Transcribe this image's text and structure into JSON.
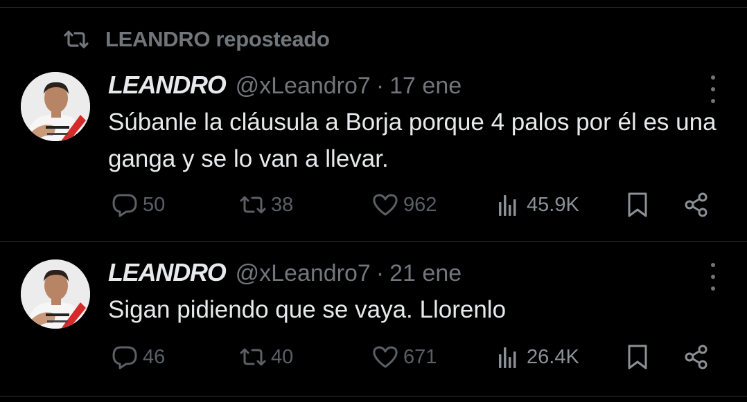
{
  "repost": {
    "label": "LEANDRO reposteado",
    "icon": "repost-icon"
  },
  "tweets": [
    {
      "name": "LEANDRO",
      "handle": "@xLeandro7",
      "separator": "·",
      "date": "17 ene",
      "text": "Súbanle la cláusula a Borja porque 4 palos por él es una ganga y se lo van a llevar.",
      "replies": "50",
      "reposts": "38",
      "likes": "962",
      "views": "45.9K"
    },
    {
      "name": "LEANDRO",
      "handle": "@xLeandro7",
      "separator": "·",
      "date": "21 ene",
      "text": "Sigan pidiendo que se vaya. Llorenlo",
      "replies": "46",
      "reposts": "40",
      "likes": "671",
      "views": "26.4K"
    }
  ],
  "icons": [
    "repost-icon",
    "more-icon",
    "reply-icon",
    "retweet-icon",
    "like-icon",
    "views-icon",
    "bookmark-icon",
    "share-icon"
  ],
  "colors": {
    "background": "#000000",
    "text": "#e7e9ea",
    "muted": "#71767b",
    "divider": "#2f3336"
  }
}
